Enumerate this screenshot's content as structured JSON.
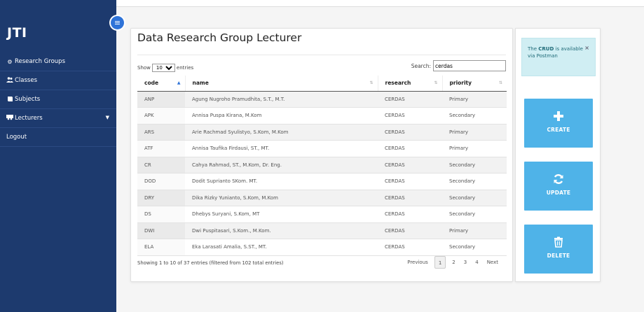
{
  "sidebar": {
    "brand": "JTI",
    "items": [
      {
        "label": "Research Groups",
        "icon": "cogs-icon"
      },
      {
        "label": "Classes",
        "icon": "users-icon"
      },
      {
        "label": "Subjects",
        "icon": "book-icon"
      },
      {
        "label": "Lecturers",
        "icon": "lecturer-icon"
      },
      {
        "label": "Logout",
        "icon": ""
      }
    ]
  },
  "main": {
    "title": "Data Research Group Lecturer",
    "show_prefix": "Show",
    "entries_value": "10",
    "show_suffix": "entries",
    "search_label": "Search:",
    "search_value": "cerdas",
    "columns": [
      "code",
      "name",
      "research",
      "priority"
    ],
    "rows": [
      [
        "ANP",
        "Agung Nugroho Pramudhita, S.T., M.T.",
        "CERDAS",
        "Primary"
      ],
      [
        "APK",
        "Annisa Puspa Kirana, M.Kom",
        "CERDAS",
        "Secondary"
      ],
      [
        "ARS",
        "Arie Rachmad Syulistyo, S.Kom, M.Kom",
        "CERDAS",
        "Primary"
      ],
      [
        "ATF",
        "Annisa Taufika Firdausi, ST., MT.",
        "CERDAS",
        "Primary"
      ],
      [
        "CR",
        "Cahya Rahmad, ST., M.Kom, Dr. Eng.",
        "CERDAS",
        "Secondary"
      ],
      [
        "DOD",
        "Dodit Suprianto SKom. MT.",
        "CERDAS",
        "Secondary"
      ],
      [
        "DRY",
        "Dika Rizky Yunianto, S.Kom, M.Kom",
        "CERDAS",
        "Secondary"
      ],
      [
        "DS",
        "Dhebys Suryani, S.Kom, MT",
        "CERDAS",
        "Secondary"
      ],
      [
        "DWI",
        "Dwi Puspitasari, S.Kom., M.Kom.",
        "CERDAS",
        "Primary"
      ],
      [
        "ELA",
        "Eka Larasati Amalia, S.ST., MT.",
        "CERDAS",
        "Secondary"
      ]
    ],
    "info": "Showing 1 to 10 of 37 entries (filtered from 102 total entries)",
    "pager": {
      "previous": "Previous",
      "pages": [
        "1",
        "2",
        "3",
        "4"
      ],
      "next": "Next"
    }
  },
  "panel": {
    "alert_pre": "The",
    "alert_bold": "CRUD",
    "alert_post": "is available via Postman",
    "alert_close": "×",
    "create_label": "CREATE",
    "update_label": "UPDATE",
    "delete_label": "DELETE"
  },
  "colors": {
    "sidebar": "#1d3a6e",
    "accent": "#2e73d8",
    "action": "#4fb3e8",
    "alert_bg": "#d0eef3"
  }
}
